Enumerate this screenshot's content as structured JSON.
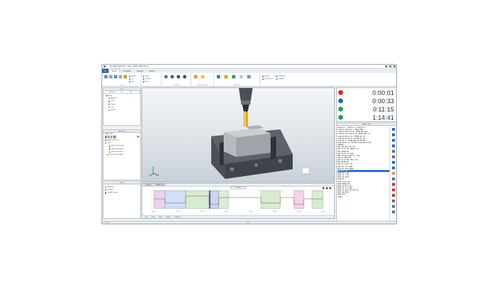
{
  "window": {
    "title": "NC SIMUL Machine - Client : RAKE_DRS Demo"
  },
  "ribbon": {
    "file_label": "File",
    "tabs": [
      "Home",
      "Simulation",
      "Analysis",
      "Options"
    ],
    "active_tab": "Home",
    "groups": [
      "Control",
      "Simulation",
      "Program analysis",
      "Advanced"
    ],
    "items": [
      "Machine",
      "Part",
      "Clamp",
      "Tool",
      "Settings",
      "Reset",
      "Continuous simulation",
      "Program",
      "Optimization",
      "Reliability",
      "Measurement",
      "Comparison",
      "Stock",
      "Tool path",
      "Machine"
    ]
  },
  "left": {
    "top_panel_title": "Tree",
    "top_subtabs": [
      "Machine",
      "Part"
    ],
    "tree": [
      "Base",
      "Machine",
      "Tool",
      "Clamp",
      "Part",
      "Fixture"
    ],
    "mid_panel_title": "Operations",
    "mid_header": "RAKE_DRS",
    "files": [
      "RAKE_DRS Part",
      "Tools",
      "3DTOOL00.7 Spin",
      "3DTOOL00 SP.2.0",
      "3DTOOL00 1FT0",
      "3DTOOL00.4 TBSM"
    ],
    "bottom_panel_title": "Output",
    "bottom_items": [
      "Animation",
      "Toolpath",
      "NanoNC Demo"
    ]
  },
  "timeline": {
    "tabs": [
      "Timeline",
      "RAKE_DRS"
    ],
    "header": "Timeline",
    "tick_labels": [
      "00:00",
      "00:10",
      "00:20",
      "00:30",
      "00:40",
      "00:50",
      "01:00",
      "01:10"
    ],
    "footer_labels": [
      "Ops",
      "Tools",
      "Feed",
      "Speed",
      "Collisions"
    ]
  },
  "timers": [
    {
      "value": "0:00:01",
      "color": "#d9262b",
      "icon": "stop-icon"
    },
    {
      "value": "0:00:33",
      "color": "#2b63b8",
      "icon": "tool-change-icon"
    },
    {
      "value": "0:11:15",
      "color": "#2c9c5a",
      "icon": "play-icon"
    },
    {
      "value": "1:14:41",
      "color": "#2c9c5a",
      "icon": "total-time-icon"
    }
  ],
  "nc": {
    "panel_title": "RAKE_DRS",
    "highlight_index": 20,
    "lines": [
      "Sequence : Machine 1 Channel 1",
      "Complete Machine : RAKE_DRS",
      "Loading Machine V1 'RAKE_DRS.mac'",
      "Loading Tool Sheet V1 'RAKE_DRS.tls'",
      "Loading Stock V1 'STOCK_01.stl'",
      "Loading Clamp V1 'CLAMP_01.stl'",
      "Program V1 'RAKE_DRS_NC_RN.MPF'",
      "Subprogram V1 'MillCircleMeasure.SPF'",
      "(BEGIN)",
      "N10 G90 G94 G17 G71",
      "N20 T1 D1 M6 (DRILL 8)",
      "N30 S2000 M3",
      "N40 G0 X0 Y0 Z100",
      "N50 CYCLE81(100,0,2,-10)",
      "N60 G0 Z100 M5",
      "N70 T2 D1 M6 (MILL 12)",
      "N80 S4000 M3",
      "N90 G0 X-20 Y-20",
      "N100 G1 Z-5 F500",
      "N110 G1 X60 F1200",
      "N120 G1 Y60",
      "N130 G1 X-20",
      "N140 G1 Y-20",
      "N150 G0 Z100",
      "N160 M5",
      "N170 T3 D1 M6",
      "N180 S6000 M3",
      "N190 G0 X10 Y10",
      "N200 G1 Z-2 F300",
      "N210 G2 X30 Y10 I10 J0",
      "N220 G0 Z100",
      "N230 M30",
      "(END)"
    ],
    "footer": "Show sequence"
  },
  "status": {
    "left": "Ready",
    "mid": "Idle"
  },
  "colors": {
    "ribbon_blue": "#2a5e9c",
    "highlight": "#2f6fbe",
    "tool_gold": "#e0a81c"
  }
}
